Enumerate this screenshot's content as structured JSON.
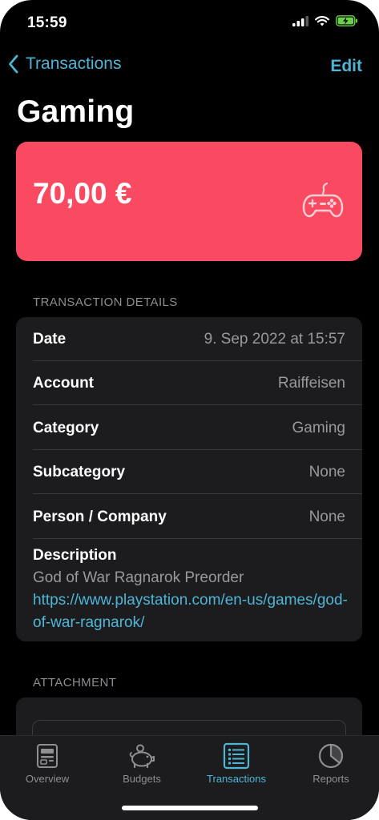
{
  "status_bar": {
    "time": "15:59"
  },
  "nav": {
    "back_label": "Transactions",
    "edit_label": "Edit"
  },
  "page": {
    "title": "Gaming"
  },
  "amount": {
    "value": "70,00 €",
    "card_color": "#fa4a62"
  },
  "details": {
    "section_title": "TRANSACTION DETAILS",
    "rows": [
      {
        "label": "Date",
        "value": "9. Sep 2022 at 15:57"
      },
      {
        "label": "Account",
        "value": "Raiffeisen"
      },
      {
        "label": "Category",
        "value": "Gaming"
      },
      {
        "label": "Subcategory",
        "value": "None"
      },
      {
        "label": "Person / Company",
        "value": "None"
      }
    ],
    "description_label": "Description",
    "description_text": "God of War Ragnarok Preorder ",
    "description_link": "https://www.playstation.com/en-us/games/god-of-war-ragnarok/"
  },
  "attachment": {
    "section_title": "ATTACHMENT"
  },
  "tabs": [
    {
      "label": "Overview",
      "icon": "overview-icon",
      "active": false
    },
    {
      "label": "Budgets",
      "icon": "piggy-bank-icon",
      "active": false
    },
    {
      "label": "Transactions",
      "icon": "list-icon",
      "active": true
    },
    {
      "label": "Reports",
      "icon": "pie-chart-icon",
      "active": false
    }
  ],
  "colors": {
    "accent": "#4db6d6",
    "background": "#000000",
    "card": "#1c1c1e",
    "secondary_text": "#98989f"
  }
}
